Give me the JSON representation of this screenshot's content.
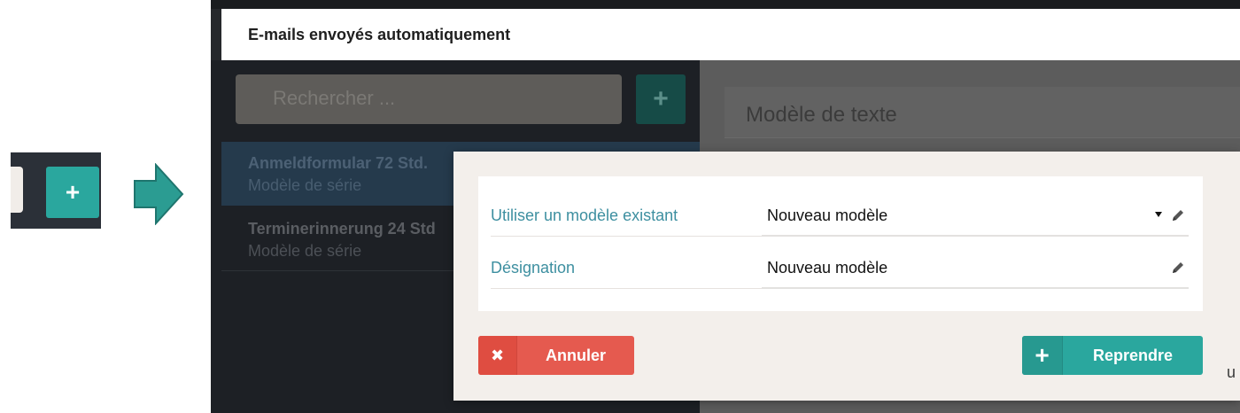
{
  "callout": {
    "plus_label": "+"
  },
  "modal": {
    "title": "E-mails envoyés automatiquement"
  },
  "background": {
    "search_placeholder": "Rechercher ...",
    "add_label": "+",
    "list": [
      {
        "title": "Anmeldformular 72 Std.",
        "subtitle": "Modèle de série"
      },
      {
        "title": "Terminerinnerung 24 Std",
        "subtitle": "Modèle de série"
      }
    ],
    "card_title": "Modèle de texte",
    "edge_text": "u"
  },
  "dialog": {
    "fields": [
      {
        "label": "Utiliser un modèle existant",
        "value": "Nouveau modèle"
      },
      {
        "label": "Désignation",
        "value": "Nouveau modèle"
      }
    ],
    "cancel_label": "Annuler",
    "cancel_icon": "✖",
    "confirm_label": "Reprendre",
    "confirm_icon": "+"
  },
  "colors": {
    "accent": "#2aa79e",
    "danger": "#e55a4f",
    "label": "#3d8fa0"
  }
}
